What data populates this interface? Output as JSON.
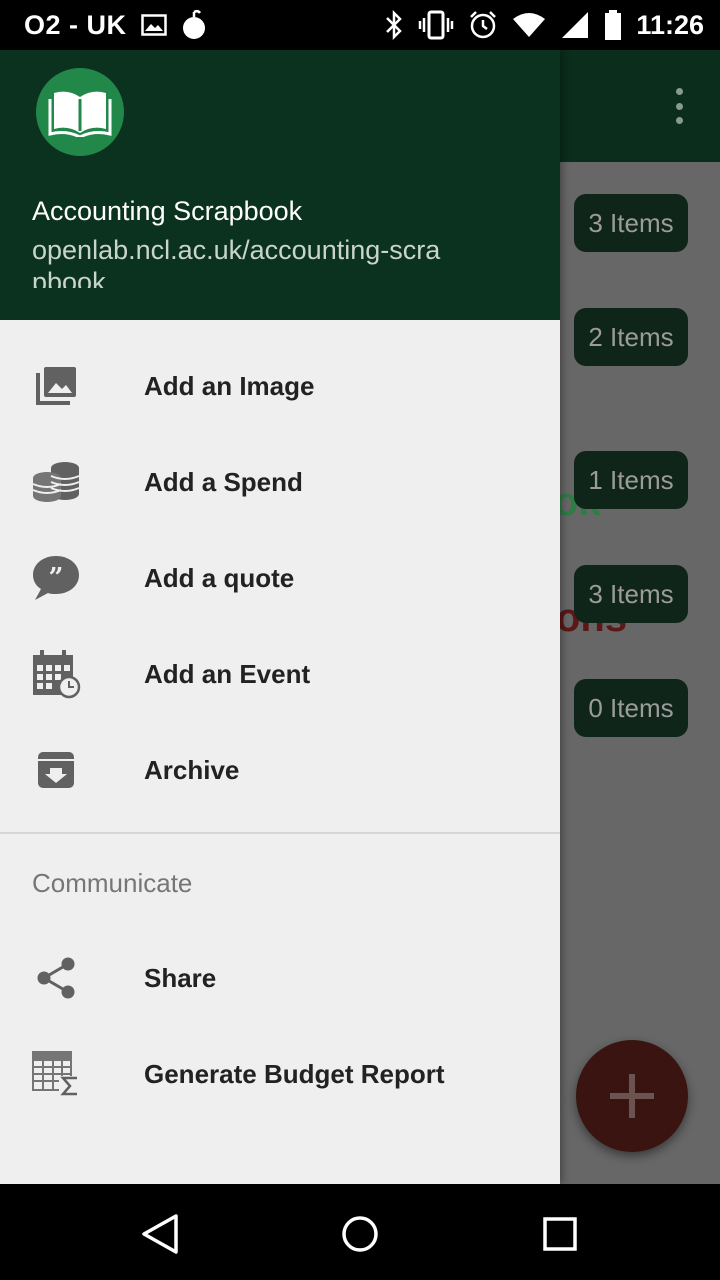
{
  "status_bar": {
    "carrier": "O2 - UK",
    "time": "11:26",
    "icons": [
      "image-icon",
      "bomb-icon",
      "bluetooth-icon",
      "vibrate-icon",
      "alarm-icon",
      "wifi-icon",
      "signal-icon",
      "battery-icon"
    ]
  },
  "background_app": {
    "badges": [
      "3 Items",
      "2 Items",
      "1 Items",
      "3 Items",
      "0 Items"
    ],
    "colors": {
      "toolbar": "#0a2d1c",
      "badge": "#0f2519",
      "fab": "#3a1410"
    }
  },
  "drawer": {
    "header": {
      "app_name": "Accounting Scrapbook",
      "app_url": "openlab.ncl.ac.uk/accounting-scrapbook",
      "logo_icon": "open-book-icon",
      "color": "#0a321e"
    },
    "items": [
      {
        "label": "Add an Image",
        "icon": "image-stack-icon"
      },
      {
        "label": "Add a Spend",
        "icon": "coins-icon"
      },
      {
        "label": "Add a quote",
        "icon": "quote-bubble-icon"
      },
      {
        "label": "Add an Event",
        "icon": "calendar-clock-icon"
      },
      {
        "label": "Archive",
        "icon": "archive-icon"
      }
    ],
    "section": {
      "title": "Communicate",
      "items": [
        {
          "label": "Share",
          "icon": "share-icon"
        },
        {
          "label": "Generate Budget Report",
          "icon": "spreadsheet-sum-icon"
        }
      ]
    }
  },
  "nav_bar": {
    "buttons": [
      "back-icon",
      "home-icon",
      "recents-icon"
    ]
  }
}
